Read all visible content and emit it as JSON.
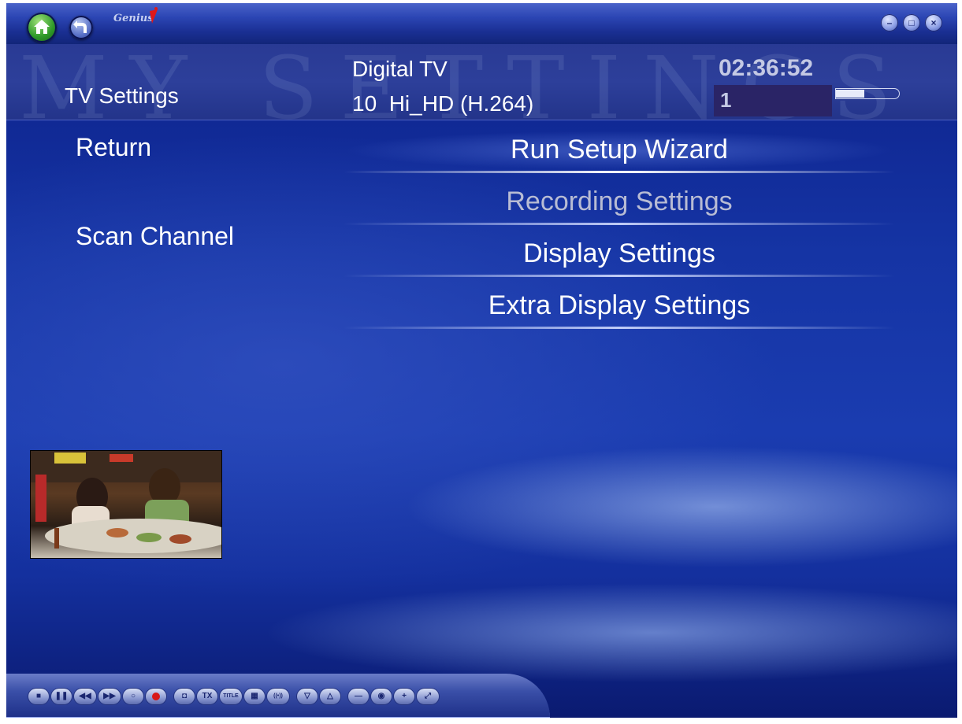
{
  "window": {
    "logo_text": "Genius",
    "minimize_label": "–",
    "maximize_label": "□",
    "close_label": "×"
  },
  "header": {
    "watermark": "MY SETTINGS",
    "page_title": "TV Settings",
    "source": "Digital TV",
    "channel_info": "10  Hi_HD (H.264)",
    "clock": "02:36:52",
    "channel_number": "1",
    "signal_strength": 0.45
  },
  "left_menu": {
    "items": [
      {
        "label": "Return"
      },
      {
        "label": "Scan Channel"
      }
    ]
  },
  "main_menu": {
    "items": [
      {
        "label": "Run Setup Wizard",
        "state": "selected"
      },
      {
        "label": "Recording Settings",
        "state": "disabled"
      },
      {
        "label": "Display Settings",
        "state": "normal"
      },
      {
        "label": "Extra Display Settings",
        "state": "normal"
      }
    ]
  },
  "controls": [
    {
      "name": "stop",
      "glyph": "■"
    },
    {
      "name": "pause",
      "glyph": "❚❚"
    },
    {
      "name": "rewind",
      "glyph": "◀◀"
    },
    {
      "name": "fast-forward",
      "glyph": "▶▶"
    },
    {
      "name": "timeshift",
      "glyph": "○"
    },
    {
      "name": "record",
      "glyph": ""
    },
    {
      "name": "snapshot",
      "glyph": "◘"
    },
    {
      "name": "teletext",
      "glyph": "TX"
    },
    {
      "name": "title",
      "glyph": "TITLE"
    },
    {
      "name": "epg",
      "glyph": "▦"
    },
    {
      "name": "audio",
      "glyph": "((•))"
    },
    {
      "name": "channel-down",
      "glyph": "▽"
    },
    {
      "name": "channel-up",
      "glyph": "△"
    },
    {
      "name": "volume-down",
      "glyph": "—"
    },
    {
      "name": "mute",
      "glyph": "◉"
    },
    {
      "name": "volume-up",
      "glyph": "+"
    },
    {
      "name": "fullscreen",
      "glyph": "⤢"
    }
  ]
}
